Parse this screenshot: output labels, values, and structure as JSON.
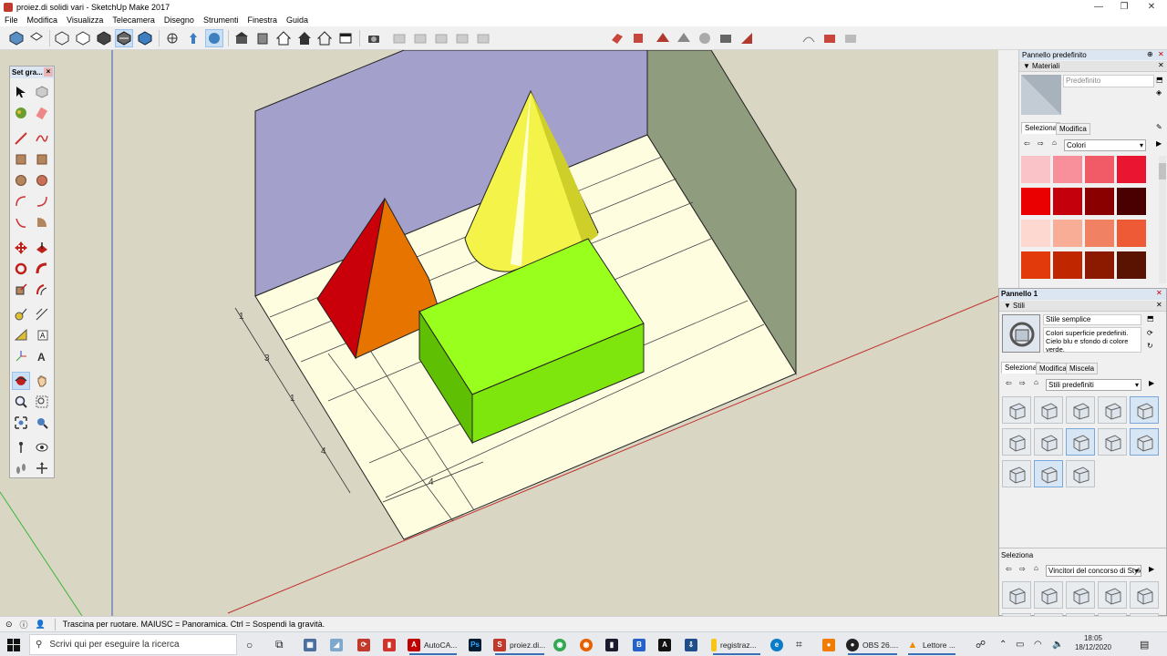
{
  "window": {
    "title": "proiez.di solidi vari - SketchUp Make 2017",
    "controls": {
      "minimize": "—",
      "restore": "❐",
      "close": "✕"
    }
  },
  "menu": [
    "File",
    "Modifica",
    "Visualizza",
    "Telecamera",
    "Disegno",
    "Strumenti",
    "Finestra",
    "Guida"
  ],
  "toolset": {
    "title": "Set gra...",
    "close": "×"
  },
  "viewport": {
    "dimensions": [
      "1",
      "3",
      "1",
      "4",
      "4"
    ],
    "colors": {
      "background": "#d9d6c3",
      "wall": "#a4a0cc",
      "side_wall": "#909c7e",
      "floor": "#fffde0",
      "pyramid_left": "#c9000a",
      "pyramid_right": "#e87400",
      "cone": "#f3f34a",
      "box_top": "#99ff1c",
      "box_front": "#7ee60c",
      "box_side": "#5fbf02"
    }
  },
  "default_panel": {
    "title": "Pannello predefinito",
    "materials": {
      "header": "Materiali",
      "current_name": "Predefinito",
      "tabs": [
        "Seleziona",
        "Modifica"
      ],
      "library": "Colori",
      "swatches": [
        "#f9c3c8",
        "#f7909b",
        "#f15a67",
        "#ea1530",
        "#ea0000",
        "#c4000d",
        "#8a0000",
        "#4a0000",
        "#fcd8d0",
        "#f8ad97",
        "#f08163",
        "#ee5a35",
        "#e23a0a",
        "#c02600",
        "#8b1a00",
        "#5a1300"
      ]
    }
  },
  "panel1": {
    "title": "Pannello 1",
    "styles": {
      "header": "Stili",
      "style_name": "Stile semplice",
      "style_desc": "Colori superficie predefiniti. Cielo blu e sfondo di colore verde.",
      "tabs": [
        "Seleziona",
        "Modifica",
        "Miscela"
      ],
      "library": "Stili predefiniti",
      "second_section": "Seleziona",
      "second_library": "Vincitori del concorso di Style"
    }
  },
  "statusbar": {
    "text": "Trascina per ruotare. MAIUSC = Panoramica. Ctrl = Sospendi la gravità."
  },
  "taskbar": {
    "search_placeholder": "Scrivi qui per eseguire la ricerca",
    "items": [
      {
        "label": "AutoCA...",
        "color": "#c00000",
        "glyph": "A"
      },
      {
        "label": "proiez.di...",
        "color": "#c0392b",
        "glyph": "S"
      },
      {
        "label": "registraz...",
        "color": "#f5c518",
        "glyph": ""
      },
      {
        "label": "OBS 26....",
        "color": "#222222",
        "glyph": "●"
      },
      {
        "label": "Lettore ...",
        "color": "#f08a00",
        "glyph": "▲"
      }
    ],
    "time": "18:05",
    "date": "18/12/2020"
  }
}
